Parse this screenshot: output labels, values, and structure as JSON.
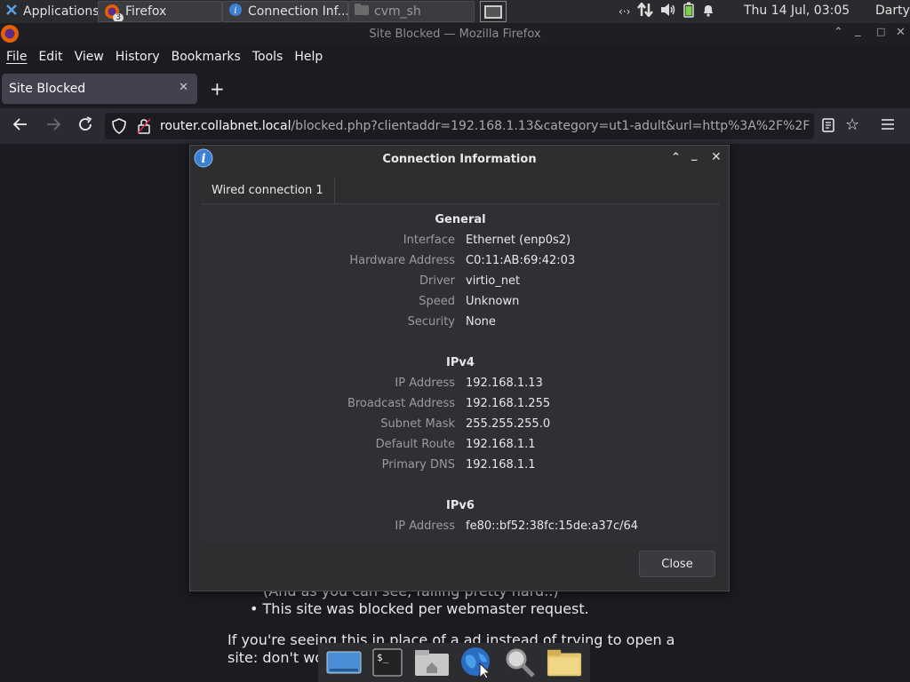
{
  "panel": {
    "applications": "Applications",
    "tasks": [
      {
        "label": "Firefox",
        "badge": "3"
      },
      {
        "label": "Connection Inf..."
      },
      {
        "label": "cvm_sh"
      }
    ],
    "datetime": "Thu 14 Jul, 03:05",
    "user": "Darty uwu"
  },
  "firefox": {
    "window_title": "Site Blocked — Mozilla Firefox",
    "menu": [
      "File",
      "Edit",
      "View",
      "History",
      "Bookmarks",
      "Tools",
      "Help"
    ],
    "tab_title": "Site Blocked",
    "url_host": "router.collabnet.local",
    "url_path": "/blocked.php?clientaddr=192.168.1.13&category=ut1-adult&url=http%3A%2F%2F"
  },
  "page": {
    "partial_line": "(And as you can see, failing pretty hard..)",
    "bullet": "This site was blocked per webmaster request.",
    "para_line1": "If you're seeing this in place of a ad instead of trying to open a",
    "para_line2_start": "site: don't wo"
  },
  "dialog": {
    "title": "Connection Information",
    "tab": "Wired connection 1",
    "sections": {
      "general": {
        "heading": "General",
        "rows": [
          {
            "label": "Interface",
            "value": "Ethernet (enp0s2)"
          },
          {
            "label": "Hardware Address",
            "value": "C0:11:AB:69:42:03"
          },
          {
            "label": "Driver",
            "value": "virtio_net"
          },
          {
            "label": "Speed",
            "value": "Unknown"
          },
          {
            "label": "Security",
            "value": "None"
          }
        ]
      },
      "ipv4": {
        "heading": "IPv4",
        "rows": [
          {
            "label": "IP Address",
            "value": "192.168.1.13"
          },
          {
            "label": "Broadcast Address",
            "value": "192.168.1.255"
          },
          {
            "label": "Subnet Mask",
            "value": "255.255.255.0"
          },
          {
            "label": "Default Route",
            "value": "192.168.1.1"
          },
          {
            "label": "Primary DNS",
            "value": "192.168.1.1"
          }
        ]
      },
      "ipv6": {
        "heading": "IPv6",
        "rows": [
          {
            "label": "IP Address",
            "value": "fe80::bf52:38fc:15de:a37c/64"
          }
        ]
      }
    },
    "close_label": "Close"
  },
  "dock": [
    "desktop-icon",
    "terminal-icon",
    "home-folder-icon",
    "web-browser-icon",
    "search-icon",
    "files-icon"
  ]
}
